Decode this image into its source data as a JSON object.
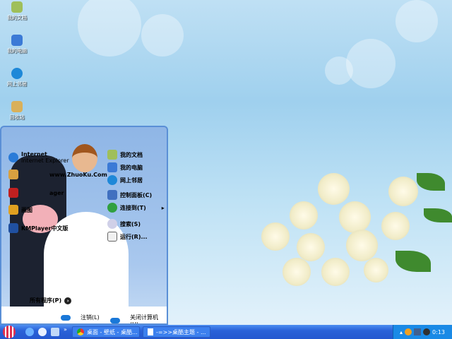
{
  "desktop": {
    "icons": [
      {
        "label": "我的文档",
        "icon": "my-documents-icon",
        "color": "#9fbf5a"
      },
      {
        "label": "我的电脑",
        "icon": "my-computer-icon",
        "color": "#3b7ad6"
      },
      {
        "label": "网上邻居",
        "icon": "network-icon",
        "color": "#1e88d8"
      },
      {
        "label": "回收站",
        "icon": "recycle-bin-icon",
        "color": "#d9b05a"
      }
    ]
  },
  "start_menu": {
    "left": [
      {
        "label": "Internet",
        "sub": "Internet Explorer",
        "icon": "ie-icon",
        "color": "#2a7bd8"
      },
      {
        "label": "www.ZhuoKu.Com",
        "icon": "app-icon",
        "color": "#d8a040"
      },
      {
        "label": "ager",
        "icon": "book-icon",
        "color": "#c02020"
      },
      {
        "label": "画图",
        "icon": "paint-icon",
        "color": "#e0a020"
      },
      {
        "label": "KMPlayer中文版",
        "icon": "kmplayer-icon",
        "color": "#2050a0"
      }
    ],
    "all_programs": "所有程序(P)",
    "right": [
      {
        "label": "我的文档",
        "icon": "my-documents-icon",
        "color": "#9fbf5a"
      },
      {
        "label": "我的电脑",
        "icon": "my-computer-icon",
        "color": "#3b7ad6"
      },
      {
        "label": "网上邻居",
        "icon": "network-icon",
        "color": "#1e88d8"
      },
      {
        "label": "控制面板(C)",
        "icon": "control-panel-icon",
        "color": "#4070c0"
      },
      {
        "label": "连接到(T)",
        "icon": "connect-icon",
        "color": "#30a040"
      },
      {
        "label": "搜索(S)",
        "icon": "search-icon",
        "color": "#d0d0e8"
      },
      {
        "label": "运行(R)...",
        "icon": "run-icon",
        "color": "#f0f0f0"
      }
    ],
    "logoff": "注销(L)",
    "shutdown": "关闭计算机(U)"
  },
  "taskbar": {
    "tasks": [
      {
        "label": "桌面 - 壁纸 - 桌酷...",
        "icon": "chrome-icon"
      },
      {
        "label": "-=>>桌酷主题 - ...",
        "icon": "document-icon"
      }
    ],
    "clock": "0:13",
    "more": "»"
  }
}
